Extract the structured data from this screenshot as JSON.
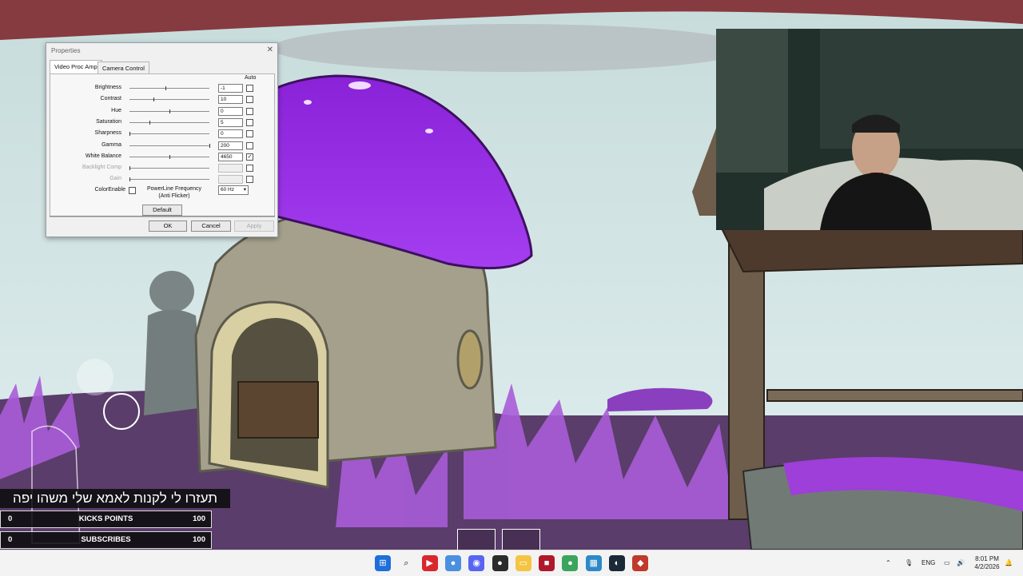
{
  "dialog": {
    "title": "Properties",
    "tabs": [
      "Video Proc Amp",
      "Camera Control"
    ],
    "auto_header": "Auto",
    "rows": [
      {
        "label": "Brightness",
        "value": "-1",
        "level": 0.45,
        "auto": false,
        "enabled": true
      },
      {
        "label": "Contrast",
        "value": "10",
        "level": 0.3,
        "auto": false,
        "enabled": true
      },
      {
        "label": "Hue",
        "value": "0",
        "level": 0.5,
        "auto": false,
        "enabled": true
      },
      {
        "label": "Saturation",
        "value": "5",
        "level": 0.25,
        "auto": false,
        "enabled": true
      },
      {
        "label": "Sharpness",
        "value": "0",
        "level": 0.0,
        "auto": false,
        "enabled": true
      },
      {
        "label": "Gamma",
        "value": "200",
        "level": 1.0,
        "auto": false,
        "enabled": true
      },
      {
        "label": "White Balance",
        "value": "4650",
        "level": 0.5,
        "auto": true,
        "enabled": true
      },
      {
        "label": "Backlight Comp",
        "value": "",
        "level": 0.0,
        "auto": false,
        "enabled": false
      },
      {
        "label": "Gain",
        "value": "",
        "level": 0.0,
        "auto": false,
        "enabled": false
      }
    ],
    "color_enable_label": "ColorEnable",
    "powerline_label_1": "PowerLine Frequency",
    "powerline_label_2": "(Anti Flicker)",
    "powerline_value": "60 Hz",
    "default_button": "Default",
    "ok_button": "OK",
    "cancel_button": "Cancel",
    "apply_button": "Apply"
  },
  "overlay": {
    "marquee_text": "תעזרו לי לקנות לאמא שלי משהו יפה",
    "counters": [
      {
        "left": "0",
        "label": "KICKS POINTS",
        "right": "100"
      },
      {
        "left": "0",
        "label": "SUBSCRIBES",
        "right": "100"
      }
    ]
  },
  "taskbar": {
    "apps": [
      {
        "name": "windows-start-icon",
        "color": "#1e6fd9",
        "glyph": "⊞"
      },
      {
        "name": "search-icon",
        "color": "transparent",
        "glyph": "⌕"
      },
      {
        "name": "red-app-icon",
        "color": "#d9272e",
        "glyph": "▶"
      },
      {
        "name": "chrome-icon",
        "color": "#4a8fe0",
        "glyph": "●"
      },
      {
        "name": "discord-icon",
        "color": "#5865f2",
        "glyph": "◉"
      },
      {
        "name": "obs-icon",
        "color": "#2b2b2b",
        "glyph": "●"
      },
      {
        "name": "file-explorer-icon",
        "color": "#f5c542",
        "glyph": "▭"
      },
      {
        "name": "red-square-app-icon",
        "color": "#b0182b",
        "glyph": "■"
      },
      {
        "name": "chrome-alt-icon",
        "color": "#3ba55c",
        "glyph": "●"
      },
      {
        "name": "grid-app-icon",
        "color": "#2d89c8",
        "glyph": "▦"
      },
      {
        "name": "steam-icon",
        "color": "#1b2838",
        "glyph": "◐"
      },
      {
        "name": "red-tool-icon",
        "color": "#c0392b",
        "glyph": "◆"
      }
    ],
    "tray": {
      "language": "ENG",
      "time": "8:01 PM",
      "date": "4/2/2026"
    }
  }
}
